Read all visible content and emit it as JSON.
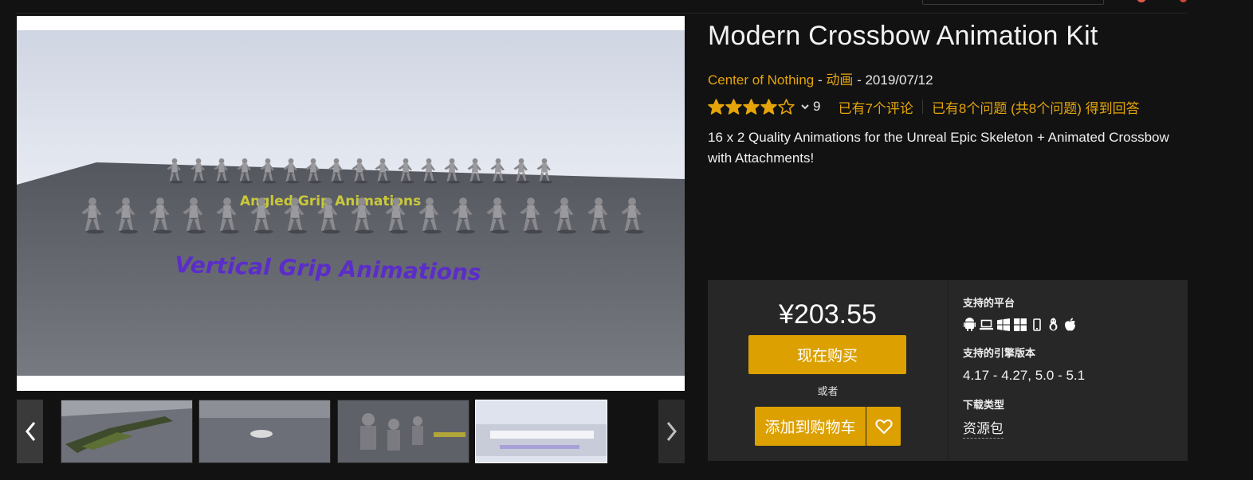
{
  "product": {
    "title": "Modern Crossbow Animation Kit",
    "seller": "Center of Nothing",
    "category": "动画",
    "release_date": "2019/07/12",
    "meta_separator": " - ",
    "rating": 4,
    "rating_max": 5,
    "rating_count": "9",
    "reviews_link": "已有7个评论",
    "questions_link": "已有8个问题 (共8个问题) 得到回答",
    "description": "16 x 2 Quality Animations for the Unreal Epic Skeleton + Animated Crossbow with Attachments!"
  },
  "gallery": {
    "main_image_texts": {
      "angled": "Angled Grip Animations",
      "vertical": "Vertical Grip Animations"
    },
    "thumbnail_count": 4,
    "selected_thumbnail": 4
  },
  "purchase": {
    "price": "¥203.55",
    "buy_now_label": "现在购买",
    "or_label": "或者",
    "add_to_cart_label": "添加到购物车"
  },
  "specs": {
    "platforms_label": "支持的平台",
    "platform_icons": [
      "android-icon",
      "laptop-icon",
      "windows-icon",
      "windows-icon",
      "mobile-icon",
      "linux-icon",
      "apple-icon"
    ],
    "engine_label": "支持的引擎版本",
    "engine_versions": "4.17 - 4.27, 5.0 - 5.1",
    "download_type_label": "下载类型",
    "download_type": "资源包"
  },
  "colors": {
    "accent": "#DCA100",
    "link": "#E5A50A",
    "page_background": "#121212",
    "panel_background": "#272727",
    "vertical_text": "#5B2DC8",
    "angled_text": "#C8C83A"
  }
}
